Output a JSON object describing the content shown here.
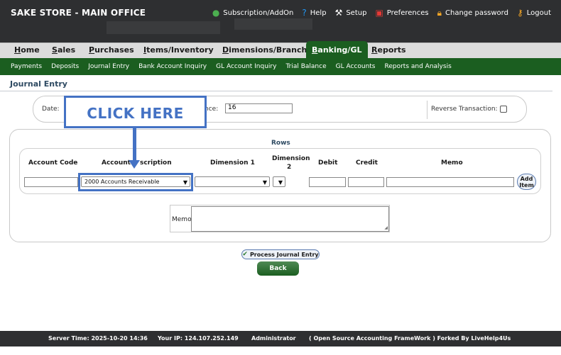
{
  "header": {
    "company": "SAKE STORE - MAIN OFFICE",
    "links": [
      {
        "icon": "subscription-icon",
        "label": "Subscription/AddOn",
        "color": "#4caf50"
      },
      {
        "icon": "help-icon",
        "label": "Help",
        "color": "#2196f3"
      },
      {
        "icon": "setup-icon",
        "label": "Setup",
        "color": "#ffffff"
      },
      {
        "icon": "preferences-icon",
        "label": "Preferences",
        "color": "#e53935"
      },
      {
        "icon": "lock-icon",
        "label": "Change password",
        "color": "#f9a825"
      },
      {
        "icon": "key-icon",
        "label": "Logout",
        "color": "#f9a825"
      }
    ]
  },
  "mainnav": {
    "home": {
      "first": "H",
      "rest": "ome"
    },
    "sales": {
      "first": "S",
      "rest": "ales"
    },
    "purchases": {
      "first": "P",
      "rest": "urchases"
    },
    "items": {
      "first": "I",
      "rest": "tems/Inventory"
    },
    "dimensions": {
      "first": "D",
      "rest": "imensions/Branch"
    },
    "banking": {
      "first": "B",
      "rest": "anking/GL"
    },
    "reports": {
      "first": "R",
      "rest": "eports"
    }
  },
  "subnav": [
    "Payments",
    "Deposits",
    "Journal Entry",
    "Bank Account Inquiry",
    "GL Account Inquiry",
    "Trial Balance",
    "GL Accounts",
    "Reports and Analysis"
  ],
  "page_title": "Journal Entry",
  "form": {
    "date_label": "Date:",
    "reference_label_visible": "nce:",
    "reference_value": "16",
    "reverse_label": "Reverse Transaction:",
    "rows_heading": "Rows",
    "columns": {
      "account_code": "Account Code",
      "account_desc_left": "Account",
      "account_desc_right": "scription",
      "dimension1": "Dimension 1",
      "dimension2_line1": "Dimension",
      "dimension2_line2": "2",
      "debit": "Debit",
      "credit": "Credit",
      "memo": "Memo"
    },
    "account_select_value": "2000   Accounts Receivable",
    "add_item_line1": "Add",
    "add_item_line2": "Item",
    "memo_label": "Memo"
  },
  "annotation": {
    "callout_text": "CLICK HERE",
    "color": "#4472c4"
  },
  "buttons": {
    "process": "Process Journal Entry",
    "back": "Back"
  },
  "footer": {
    "server_time": "Server Time: 2025-10-20 14:36",
    "ip": "Your IP: 124.107.252.149",
    "user": "Administrator",
    "credits": "( Open Source Accounting FrameWork ) Forked By LiveHelp4Us"
  },
  "colors": {
    "header_bg": "#2e2f31",
    "nav_green": "#1b5e20",
    "nav_gray": "#dcdcdc"
  }
}
